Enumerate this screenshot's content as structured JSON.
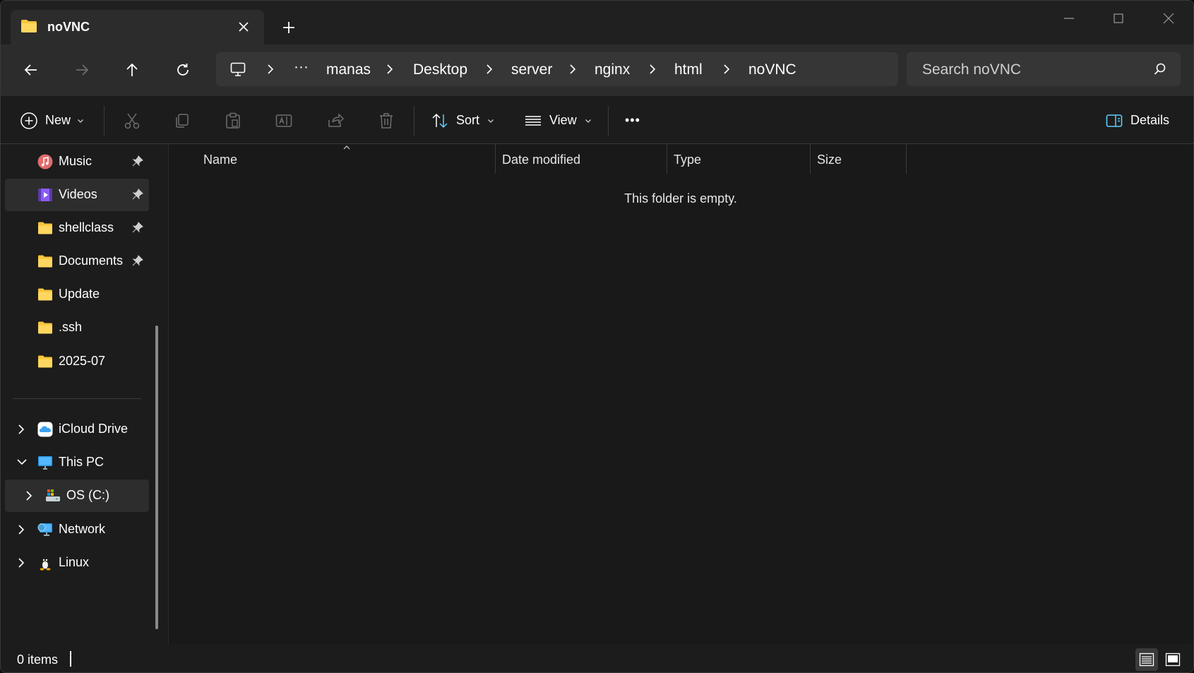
{
  "tab": {
    "title": "noVNC"
  },
  "address": {
    "overflow": "···",
    "crumbs": [
      "manas",
      "Desktop",
      "server",
      "nginx",
      "html",
      "noVNC"
    ]
  },
  "search": {
    "placeholder": "Search noVNC"
  },
  "commands": {
    "new_label": "New",
    "sort_label": "Sort",
    "view_label": "View",
    "more_label": "•••",
    "details_label": "Details"
  },
  "sidebar": {
    "pinned": [
      {
        "label": "Music",
        "icon": "music-icon",
        "pinned": true
      },
      {
        "label": "Videos",
        "icon": "videos-icon",
        "pinned": true,
        "selected": true
      },
      {
        "label": "shellclass",
        "icon": "folder-icon",
        "pinned": true
      },
      {
        "label": "Documents",
        "icon": "folder-icon",
        "pinned": true
      },
      {
        "label": "Update",
        "icon": "folder-icon"
      },
      {
        "label": ".ssh",
        "icon": "folder-icon"
      },
      {
        "label": "2025-07",
        "icon": "folder-icon"
      }
    ],
    "tree": [
      {
        "label": "iCloud Drive",
        "icon": "icloud-icon",
        "expanded": false
      },
      {
        "label": "This PC",
        "icon": "pc-icon",
        "expanded": true
      },
      {
        "label": "OS (C:)",
        "icon": "drive-icon",
        "expanded": false,
        "selected": true
      },
      {
        "label": "Network",
        "icon": "network-icon",
        "expanded": false
      },
      {
        "label": "Linux",
        "icon": "linux-icon",
        "expanded": false
      }
    ]
  },
  "columns": [
    "Name",
    "Date modified",
    "Type",
    "Size"
  ],
  "content": {
    "empty_message": "This folder is empty."
  },
  "status": {
    "count": "0 items"
  },
  "colors": {
    "accent": "#60cdff",
    "folder": "#f8c53a",
    "background": "#1c1c1c"
  }
}
